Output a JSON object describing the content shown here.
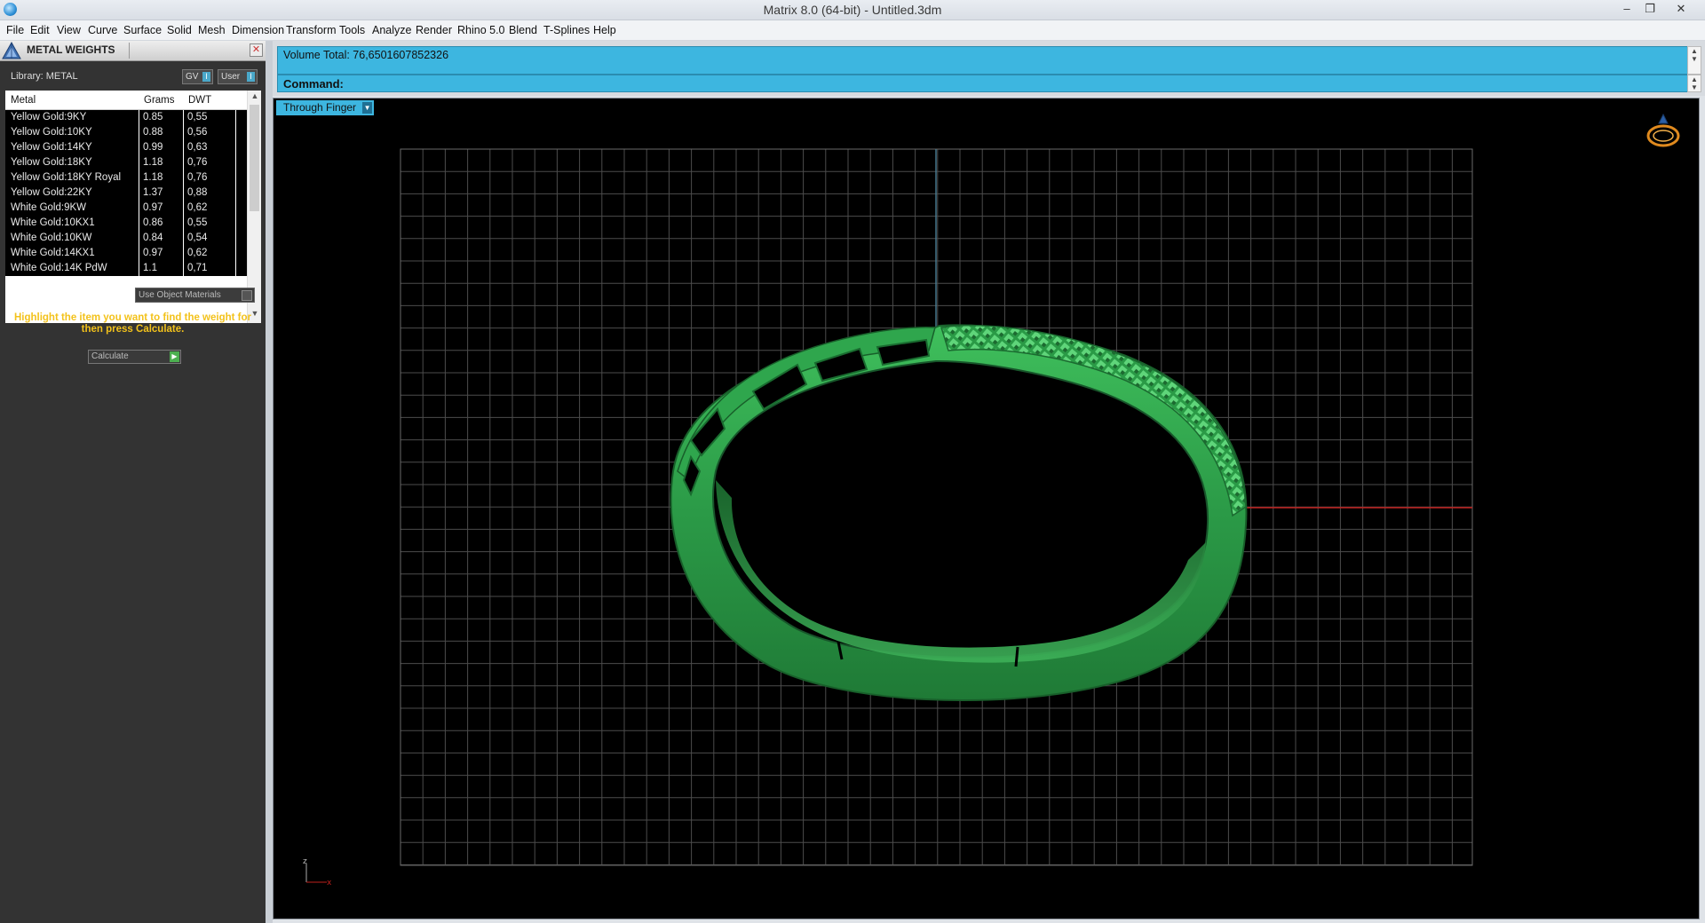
{
  "window": {
    "title": "Matrix 8.0 (64-bit) - Untitled.3dm",
    "controls": [
      "–",
      "❐",
      "✕"
    ]
  },
  "menu": [
    "File",
    "Edit",
    "View",
    "Curve",
    "Surface",
    "Solid",
    "Mesh",
    "Dimension",
    "Transform",
    "Tools",
    "Analyze",
    "Render",
    "Rhino 5.0",
    "Blend",
    "T-Splines",
    "Help"
  ],
  "panel": {
    "title": "METAL WEIGHTS",
    "library_label": "Library: METAL",
    "toggle_gv": "GV",
    "toggle_user": "User",
    "columns": [
      "Metal",
      "Grams",
      "DWT"
    ],
    "rows": [
      [
        "Yellow Gold:9KY",
        "0.85",
        "0,55"
      ],
      [
        "Yellow Gold:10KY",
        "0.88",
        "0,56"
      ],
      [
        "Yellow Gold:14KY",
        "0.99",
        "0,63"
      ],
      [
        "Yellow Gold:18KY",
        "1.18",
        "0,76"
      ],
      [
        "Yellow Gold:18KY Royal",
        "1.18",
        "0,76"
      ],
      [
        "Yellow Gold:22KY",
        "1.37",
        "0,88"
      ],
      [
        "White Gold:9KW",
        "0.97",
        "0,62"
      ],
      [
        "White Gold:10KX1",
        "0.86",
        "0,55"
      ],
      [
        "White Gold:10KW",
        "0.84",
        "0,54"
      ],
      [
        "White Gold:14KX1",
        "0.97",
        "0,62"
      ],
      [
        "White Gold:14K PdW",
        "1.1",
        "0,71"
      ]
    ],
    "use_object_materials": "Use Object Materials",
    "hint": "Highlight the item you want to find the weight for then press Calculate.",
    "calculate_button": "Calculate"
  },
  "command": {
    "history": "Volume Total: 76,6501607852326",
    "prompt": "Command:"
  },
  "viewport": {
    "label": "Through Finger",
    "model_color": "#2e9e48",
    "axis_x_color": "#c0201d",
    "axis_y_color": "#4a7e94",
    "grid_color": "#4c4c4c",
    "axis_icon_labels": {
      "x": "x",
      "z": "z"
    }
  }
}
